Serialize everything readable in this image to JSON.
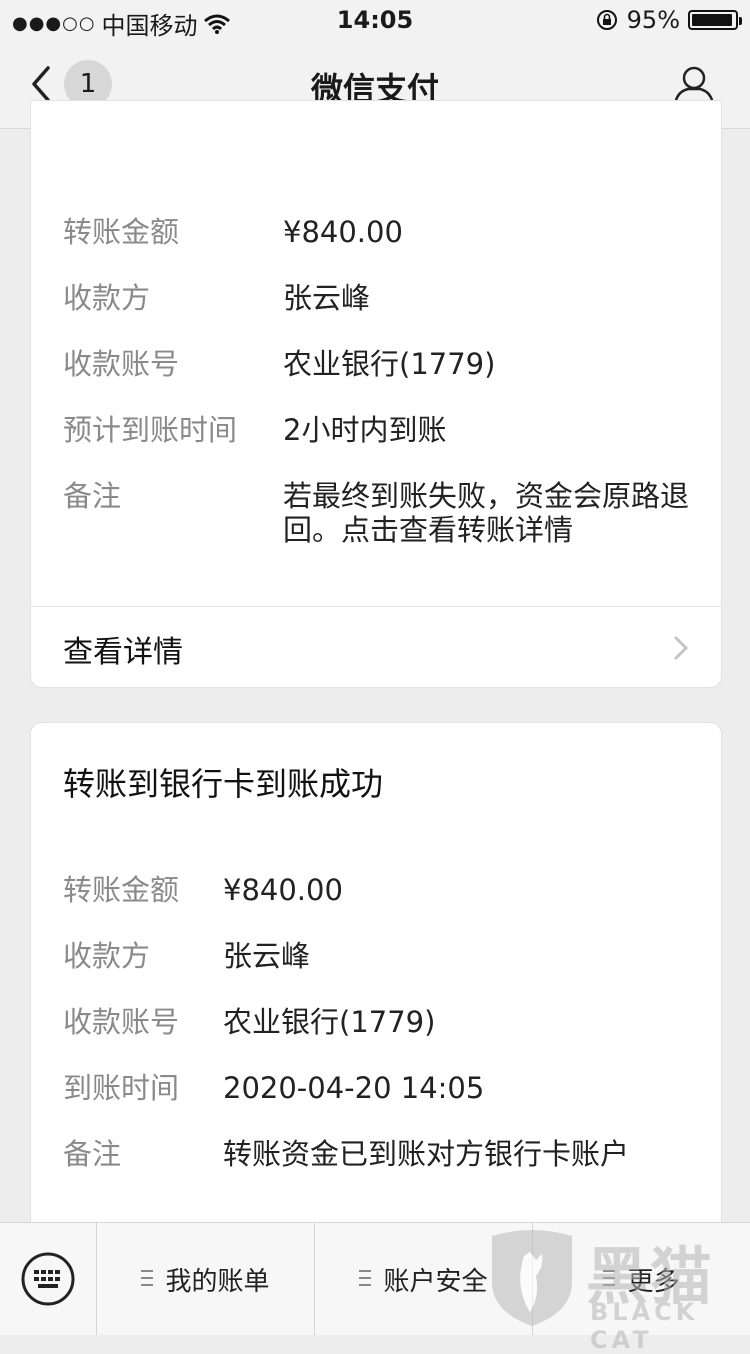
{
  "status_bar": {
    "signal_dots": "●●●○○",
    "carrier": "中国移动",
    "time": "14:05",
    "battery_percent": "95%",
    "battery_level": 0.95
  },
  "nav": {
    "title": "微信支付",
    "badge_count": "1"
  },
  "card1": {
    "rows": [
      {
        "label": "转账金额",
        "value": "¥840.00"
      },
      {
        "label": "收款方",
        "value": "张云峰"
      },
      {
        "label": "收款账号",
        "value": "农业银行(1779)"
      },
      {
        "label": "预计到账时间",
        "value": "2小时内到账"
      },
      {
        "label": "备注",
        "value": "若最终到账失败，资金会原路退回。点击查看转账详情"
      }
    ],
    "detail_label": "查看详情"
  },
  "card2": {
    "title": "转账到银行卡到账成功",
    "rows": [
      {
        "label": "转账金额",
        "value": "¥840.00"
      },
      {
        "label": "收款方",
        "value": "张云峰"
      },
      {
        "label": "收款账号",
        "value": "农业银行(1779)"
      },
      {
        "label": "到账时间",
        "value": "2020-04-20 14:05"
      },
      {
        "label": "备注",
        "value": "转账资金已到账对方银行卡账户"
      }
    ]
  },
  "bottom_bar": {
    "tabs": [
      {
        "label": "我的账单"
      },
      {
        "label": "账户安全"
      },
      {
        "label": "更多"
      }
    ]
  },
  "watermark": {
    "cn": "黑猫",
    "en": "BLACK CAT"
  }
}
